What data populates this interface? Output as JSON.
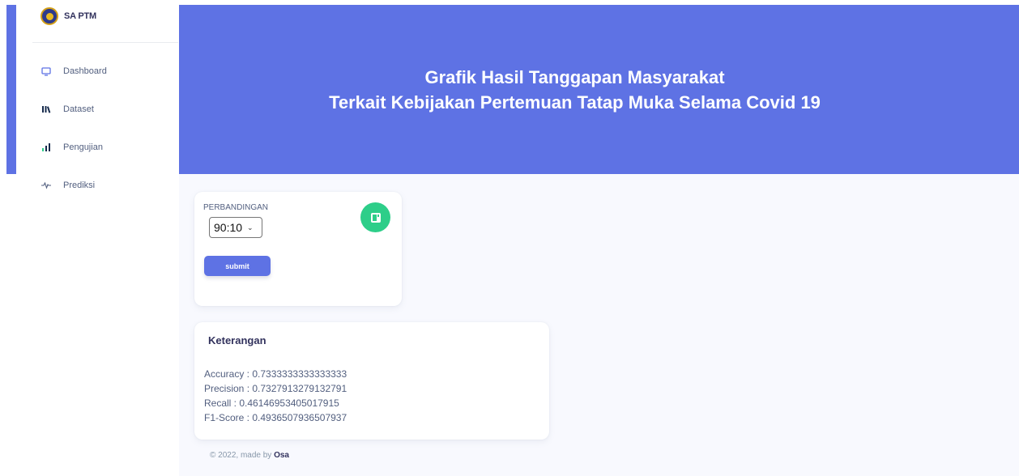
{
  "brand": {
    "name": "SA PTM",
    "logo_icon": "university-seal-icon"
  },
  "sidebar": {
    "items": [
      {
        "label": "Dashboard",
        "icon": "monitor-icon"
      },
      {
        "label": "Dataset",
        "icon": "books-icon"
      },
      {
        "label": "Pengujian",
        "icon": "bar-chart-icon"
      },
      {
        "label": "Prediksi",
        "icon": "pulse-icon"
      }
    ]
  },
  "header": {
    "title_line1": "Grafik Hasil Tanggapan Masyarakat",
    "title_line2": "Terkait Kebijakan Pertemuan Tatap Muka Selama Covid 19",
    "color": "#5e72e4"
  },
  "form": {
    "label": "PERBANDINGAN",
    "select_value": "90:10",
    "submit_label": "submit",
    "icon": "document-icon",
    "icon_color": "#2dce89"
  },
  "keterangan": {
    "title": "Keterangan",
    "accuracy": "Accuracy : 0.7333333333333333",
    "precision": "Precision : 0.7327913279132791",
    "recall": "Recall : 0.46146953405017915",
    "f1": "F1-Score : 0.4936507936507937"
  },
  "footer": {
    "prefix": "© 2022, made by",
    "author": "Osa"
  }
}
